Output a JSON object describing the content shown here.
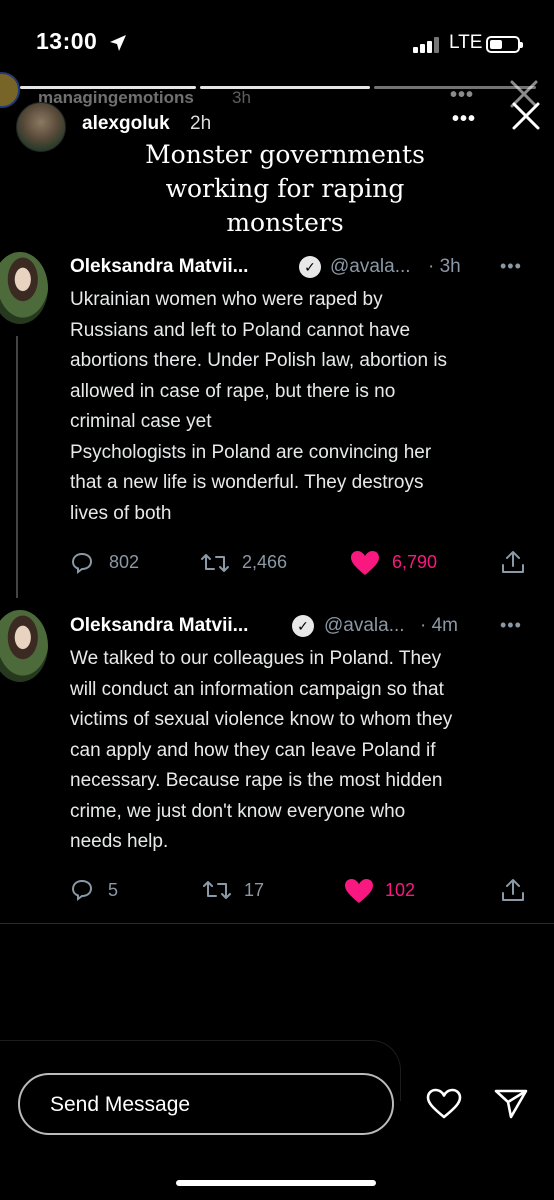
{
  "status": {
    "time": "13:00",
    "network": "LTE"
  },
  "prev_story": {
    "username": "managingemotions",
    "time": "3h"
  },
  "story": {
    "username": "alexgoluk",
    "time": "2h",
    "caption_lines": [
      "Monster governments",
      "working for raping",
      "monsters"
    ]
  },
  "tweets": [
    {
      "name": "Oleksandra Matvii...",
      "handle": "@avala...",
      "time": "· 3h",
      "lines": [
        "Ukrainian women who were raped by",
        "Russians and left to Poland cannot have",
        "abortions there. Under Polish law, abortion is",
        "allowed in case of rape, but there is no",
        "criminal case yet",
        "Psychologists in Poland are convincing her",
        "that a new life is wonderful. They destroys",
        "lives of both"
      ],
      "replies": "802",
      "retweets": "2,466",
      "likes": "6,790"
    },
    {
      "name": "Oleksandra Matvii...",
      "handle": "@avala...",
      "time": "· 4m",
      "lines": [
        "We talked to our colleagues in Poland. They",
        "will conduct an information campaign so that",
        "victims of sexual violence know to whom they",
        "can apply and how they can leave Poland if",
        "necessary. Because rape is the most hidden",
        "crime, we just don't know everyone who",
        "needs help."
      ],
      "replies": "5",
      "retweets": "17",
      "likes": "102"
    }
  ],
  "composer": {
    "placeholder": "Send Message"
  },
  "colors": {
    "like": "#f91880",
    "muted": "#8b98a5"
  }
}
